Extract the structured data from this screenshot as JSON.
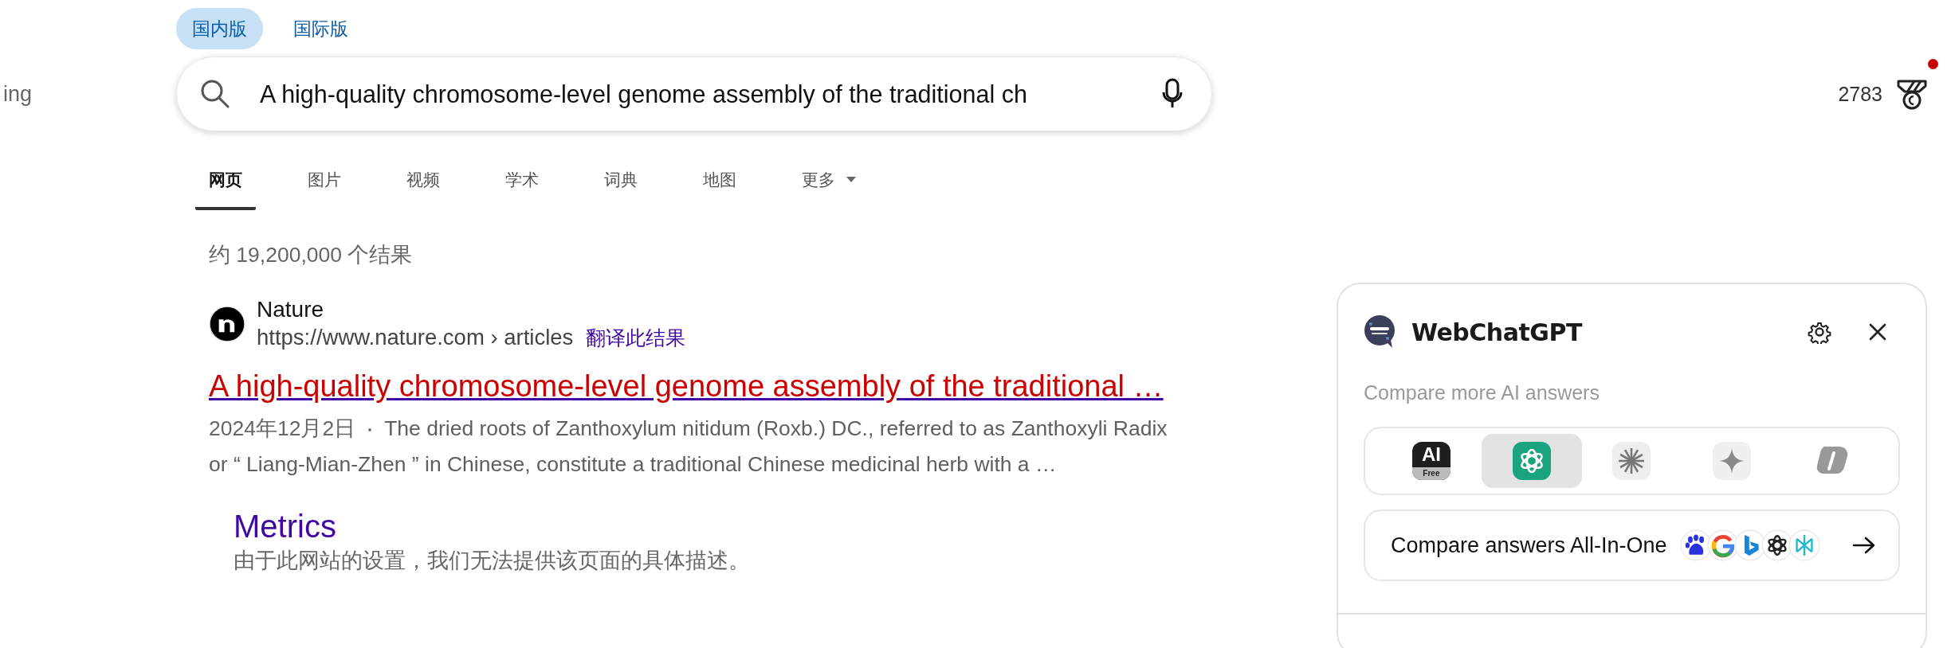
{
  "editions": [
    {
      "label": "国内版",
      "selected": true
    },
    {
      "label": "国际版",
      "selected": false
    }
  ],
  "brand": "ing",
  "search": {
    "value": "A high-quality chromosome-level genome assembly of the traditional ch"
  },
  "rewards": {
    "points": "2783",
    "notification": true
  },
  "nav_tabs": [
    {
      "label": "网页",
      "selected": true,
      "kind": "plain"
    },
    {
      "label": "图片",
      "selected": false,
      "kind": "plain"
    },
    {
      "label": "视频",
      "selected": false,
      "kind": "plain"
    },
    {
      "label": "学术",
      "selected": false,
      "kind": "plain"
    },
    {
      "label": "词典",
      "selected": false,
      "kind": "plain"
    },
    {
      "label": "地图",
      "selected": false,
      "kind": "plain"
    },
    {
      "label": "更多",
      "selected": false,
      "kind": "dropdown"
    }
  ],
  "result_count": "约 19,200,000 个结果",
  "results": [
    {
      "site": "Nature",
      "url": "https://www.nature.com › articles",
      "translate": "翻译此结果",
      "title": "A high-quality chromosome-level genome assembly of the traditional …",
      "date": "2024年12月2日",
      "snippet": "The dried roots of Zanthoxylum nitidum (Roxb.) DC., referred to as Zanthoxyli Radix or “ Liang-Mian-Zhen ” in Chinese, constitute a traditional Chinese medicinal herb with a …",
      "sitelinks": [
        {
          "title": "Metrics",
          "description": "由于此网站的设置，我们无法提供该页面的具体描述。"
        }
      ]
    }
  ],
  "panel": {
    "title": "WebChatGPT",
    "subtitle": "Compare more AI answers",
    "models": [
      {
        "kind": "badge",
        "label": "AI",
        "badge": "Free",
        "selected": false
      },
      {
        "kind": "knot",
        "selected": true
      },
      {
        "kind": "starburst",
        "selected": false
      },
      {
        "kind": "sparkle",
        "selected": false
      },
      {
        "kind": "swirl",
        "selected": false
      }
    ],
    "compare": {
      "label": "Compare answers All-In-One"
    }
  }
}
